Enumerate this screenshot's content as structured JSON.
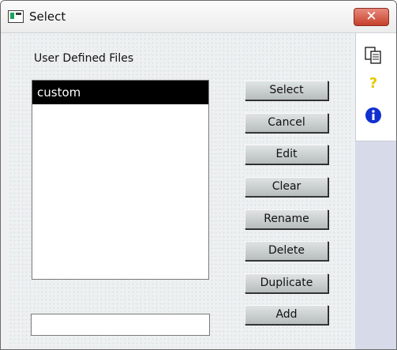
{
  "window": {
    "title": "Select",
    "close_glyph": "✕"
  },
  "list": {
    "label": "User Defined Files",
    "items": [
      {
        "label": "custom",
        "selected": true
      }
    ]
  },
  "name_field": {
    "value": ""
  },
  "buttons": [
    "Select",
    "Cancel",
    "Edit",
    "Clear",
    "Rename",
    "Delete",
    "Duplicate",
    "Add"
  ],
  "side_icons": [
    {
      "name": "copy-pages-icon",
      "glyph": "⎘"
    },
    {
      "name": "help-icon",
      "glyph": "?"
    },
    {
      "name": "info-icon",
      "glyph": "i"
    }
  ],
  "colors": {
    "selection_bg": "#000000",
    "close_button": "#c6402b",
    "help_icon": "#e6c800",
    "info_icon": "#1030d0"
  }
}
